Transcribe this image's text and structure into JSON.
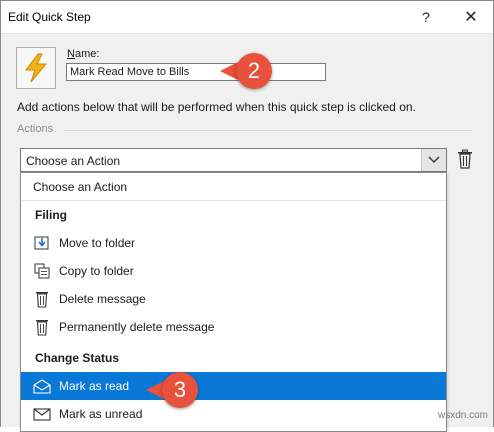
{
  "window": {
    "title": "Edit Quick Step",
    "help_glyph": "?",
    "close_glyph": "✕"
  },
  "quickstep": {
    "icon": "lightning-bolt-icon",
    "name_label_accel": "N",
    "name_label_rest": "ame:",
    "name_value": "Mark Read Move to Bills"
  },
  "instruction": "Add actions below that will be performed when this quick step is clicked on.",
  "actions_section": {
    "label": "Actions",
    "combo_value": "Choose an Action"
  },
  "dropdown": {
    "first_item": "Choose an Action",
    "groups": [
      {
        "header": "Filing",
        "items": [
          {
            "label": "Move to folder",
            "icon": "move-to-folder-icon"
          },
          {
            "label": "Copy to folder",
            "icon": "copy-to-folder-icon"
          },
          {
            "label": "Delete message",
            "icon": "trash-icon"
          },
          {
            "label": "Permanently delete message",
            "icon": "trash-icon"
          }
        ]
      },
      {
        "header": "Change Status",
        "items": [
          {
            "label": "Mark as read",
            "icon": "open-envelope-icon",
            "selected": true
          },
          {
            "label": "Mark as unread",
            "icon": "closed-envelope-icon"
          }
        ]
      }
    ]
  },
  "callouts": [
    "2",
    "3"
  ],
  "watermark": "wsxdn.com",
  "colors": {
    "selection": "#0a78d7",
    "callout": "#e8513c",
    "bolt": "#f2b21b"
  }
}
